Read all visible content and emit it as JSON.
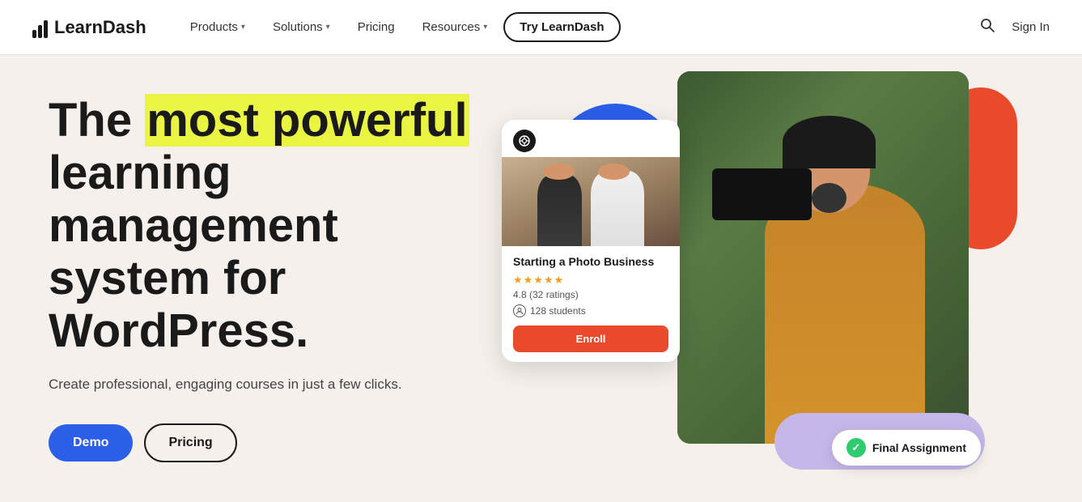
{
  "nav": {
    "logo_text": "LearnDash",
    "items": [
      {
        "label": "Products",
        "has_dropdown": true
      },
      {
        "label": "Solutions",
        "has_dropdown": true
      },
      {
        "label": "Pricing",
        "has_dropdown": false
      },
      {
        "label": "Resources",
        "has_dropdown": true
      },
      {
        "label": "Try LearnDash",
        "has_dropdown": false
      }
    ],
    "search_label": "Search",
    "signin_label": "Sign In"
  },
  "hero": {
    "title_before": "The ",
    "title_highlight": "most powerful",
    "title_after": " learning management system for WordPress.",
    "subtitle": "Create professional, engaging courses in just a few clicks.",
    "btn_demo": "Demo",
    "btn_pricing": "Pricing"
  },
  "course_card": {
    "title": "Starting a Photo Business",
    "stars": "★★★★★",
    "rating_text": "4.8 (32 ratings)",
    "students_count": "128 students",
    "enroll_label": "Enroll"
  },
  "assignment_badge": {
    "label": "Final Assignment"
  }
}
